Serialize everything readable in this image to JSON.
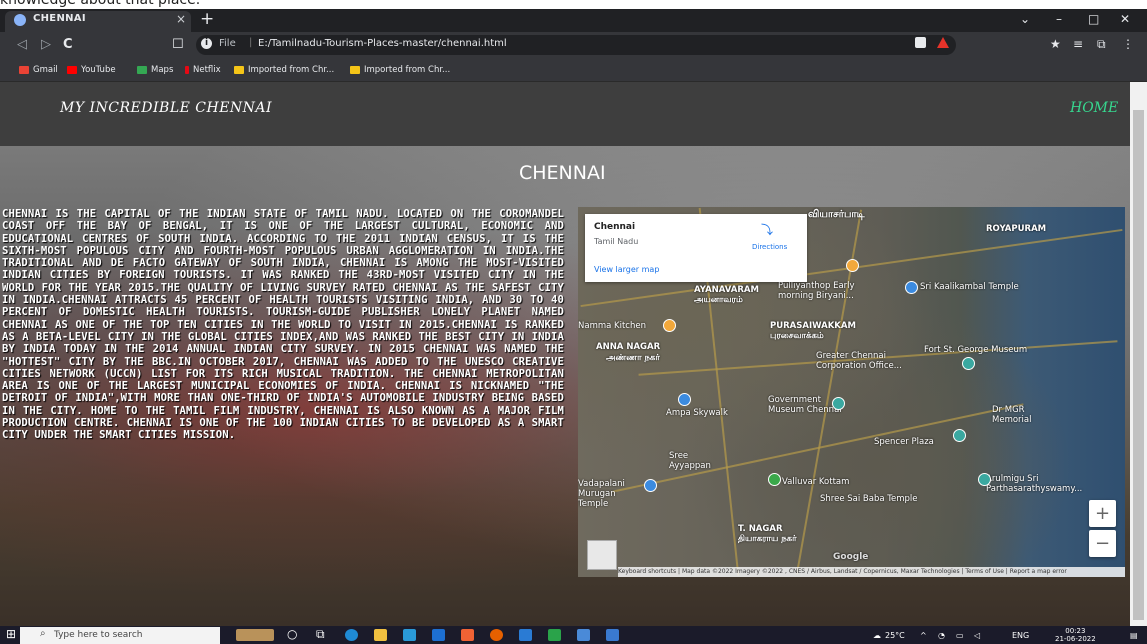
{
  "caption": "knowledge about that place.",
  "browser": {
    "tab_title": "CHENNAI",
    "tab_close": "×",
    "new_tab": "+",
    "window_controls": [
      "⌄",
      "–",
      "□",
      "✕"
    ],
    "nav": [
      "◁",
      "▷",
      "C"
    ],
    "bookmark_icon": "☐",
    "info_icon": "i",
    "file_label": "File",
    "url": "E:/Tamilnadu-Tourism-Places-master/chennai.html",
    "extension_icons": [
      "★",
      "≡",
      "⧉",
      "⋮"
    ],
    "bookmarks": [
      {
        "label": "Gmail",
        "color": "#ea4335"
      },
      {
        "label": "YouTube",
        "color": "#ff0000"
      },
      {
        "label": "Maps",
        "color": "#34a853"
      },
      {
        "label": "Netflix",
        "color": "#e50914"
      },
      {
        "label": "Imported from Chr...",
        "color": "#f5c518"
      },
      {
        "label": "Imported from Chr...",
        "color": "#f5c518"
      }
    ]
  },
  "site": {
    "brand": "MY INCREDIBLE CHENNAI",
    "home_link": "HOME",
    "title": "CHENNAI",
    "description": "CHENNAI IS THE CAPITAL OF THE INDIAN STATE OF TAMIL NADU. LOCATED ON THE COROMANDEL COAST OFF THE BAY OF BENGAL, IT IS ONE OF THE LARGEST CULTURAL, ECONOMIC AND EDUCATIONAL CENTRES OF SOUTH INDIA. ACCORDING TO THE 2011 INDIAN CENSUS, IT IS THE SIXTH-MOST POPULOUS CITY AND FOURTH-MOST POPULOUS URBAN AGGLOMERATION IN INDIA.THE TRADITIONAL AND DE FACTO GATEWAY OF SOUTH INDIA, CHENNAI IS AMONG THE MOST-VISITED INDIAN CITIES BY FOREIGN TOURISTS. IT WAS RANKED THE 43RD-MOST VISITED CITY IN THE WORLD FOR THE YEAR 2015.THE QUALITY OF LIVING SURVEY RATED CHENNAI AS THE SAFEST CITY IN INDIA.CHENNAI ATTRACTS 45 PERCENT OF HEALTH TOURISTS VISITING INDIA, AND 30 TO 40 PERCENT OF DOMESTIC HEALTH TOURISTS. TOURISM-GUIDE PUBLISHER LONELY PLANET NAMED CHENNAI AS ONE OF THE TOP TEN CITIES IN THE WORLD TO VISIT IN 2015.CHENNAI IS RANKED AS A BETA-LEVEL CITY IN THE GLOBAL CITIES INDEX,AND WAS RANKED THE BEST CITY IN INDIA BY INDIA TODAY IN THE 2014 ANNUAL INDIAN CITY SURVEY. IN 2015 CHENNAI WAS NAMED THE \"HOTTEST\" CITY BY THE BBC.IN OCTOBER 2017, CHENNAI WAS ADDED TO THE UNESCO CREATIVE CITIES NETWORK (UCCN) LIST FOR ITS RICH MUSICAL TRADITION. THE CHENNAI METROPOLITAN AREA IS ONE OF THE LARGEST MUNICIPAL ECONOMIES OF INDIA. CHENNAI IS NICKNAMED \"THE DETROIT OF INDIA\",WITH MORE THAN ONE-THIRD OF INDIA'S AUTOMOBILE INDUSTRY BEING BASED IN THE CITY. HOME TO THE TAMIL FILM INDUSTRY, CHENNAI IS ALSO KNOWN AS A MAJOR FILM PRODUCTION CENTRE. CHENNAI IS ONE OF THE 100 INDIAN CITIES TO BE DEVELOPED AS A SMART CITY UNDER THE SMART CITIES MISSION."
  },
  "map": {
    "place_name": "Chennai",
    "place_region": "Tamil Nadu",
    "directions_label": "Directions",
    "directions_icon": "⤵",
    "larger_map_link": "View larger map",
    "zoom_in": "+",
    "zoom_out": "−",
    "labels": [
      "ROYAPURAM",
      "AYANAVARAM",
      "அயனாவரம்",
      "Pulliyanthop Early morning Biryani...",
      "Sri Kaalikambal Temple",
      "Namma Kitchen",
      "PURASAIWAKKAM",
      "புரசைவாக்கம்",
      "ANNA NAGAR",
      "அண்ணா நகர்",
      "Greater Chennai Corporation Office...",
      "Fort St. George Museum",
      "Government Museum Chennai",
      "Ampa Skywalk",
      "Dr MGR Memorial",
      "Spencer Plaza",
      "Vadapalani Murugan Temple",
      "Valluvar Kottam",
      "Arulmigu Sri Parthasarathyswamy...",
      "Shree Sai Baba Temple",
      "T. NAGAR",
      "தியாகராய நகர்",
      "Sree Ayyappan",
      "Google"
    ],
    "footer": "Keyboard shortcuts | Map data ©2022 Imagery ©2022 , CNES / Airbus, Landsat / Copernicus, Maxar Technologies | Terms of Use | Report a map error"
  },
  "taskbar": {
    "search_placeholder": "Type here to search",
    "temperature": "25°C",
    "language": "ENG",
    "time": "00:23",
    "date": "21-06-2022"
  }
}
